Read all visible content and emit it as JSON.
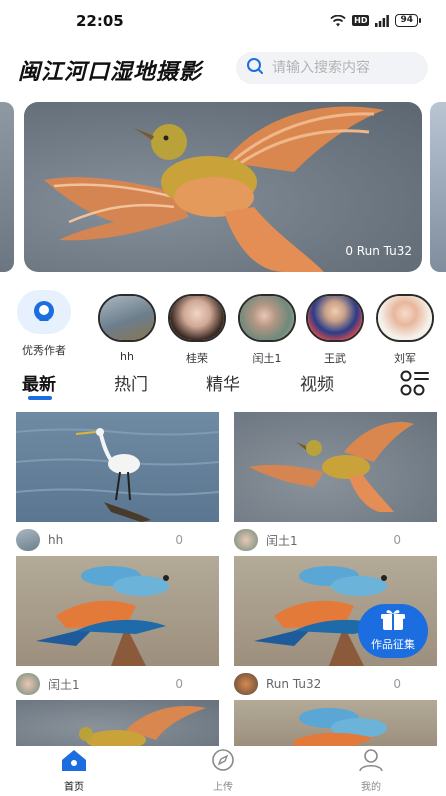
{
  "status_bar": {
    "time": "22:05",
    "hd": "HD",
    "battery": "94"
  },
  "header": {
    "title": "闽江河口湿地摄影",
    "search_placeholder": "请输入搜索内容"
  },
  "banner": {
    "caption": "0 Run Tu32"
  },
  "authors": {
    "featured_label": "优秀作者",
    "items": [
      {
        "name": "hh"
      },
      {
        "name": "桂荣"
      },
      {
        "name": "闰土1"
      },
      {
        "name": "王武"
      },
      {
        "name": "刘军"
      }
    ]
  },
  "tabs": {
    "items": [
      "最新",
      "热门",
      "精华",
      "视频"
    ],
    "active": "最新"
  },
  "feed": {
    "cards": [
      {
        "user": "hh",
        "count": "0"
      },
      {
        "user": "闰土1",
        "count": "0"
      },
      {
        "user": "闰土1",
        "count": "0"
      },
      {
        "user": "Run Tu32",
        "count": "0"
      }
    ]
  },
  "fab": {
    "label": "作品征集"
  },
  "bottom_nav": {
    "items": [
      {
        "label": "首页"
      },
      {
        "label": "上传"
      },
      {
        "label": "我的"
      }
    ]
  },
  "colors": {
    "accent": "#1c6ee0",
    "text": "#222222",
    "muted": "#999999"
  }
}
